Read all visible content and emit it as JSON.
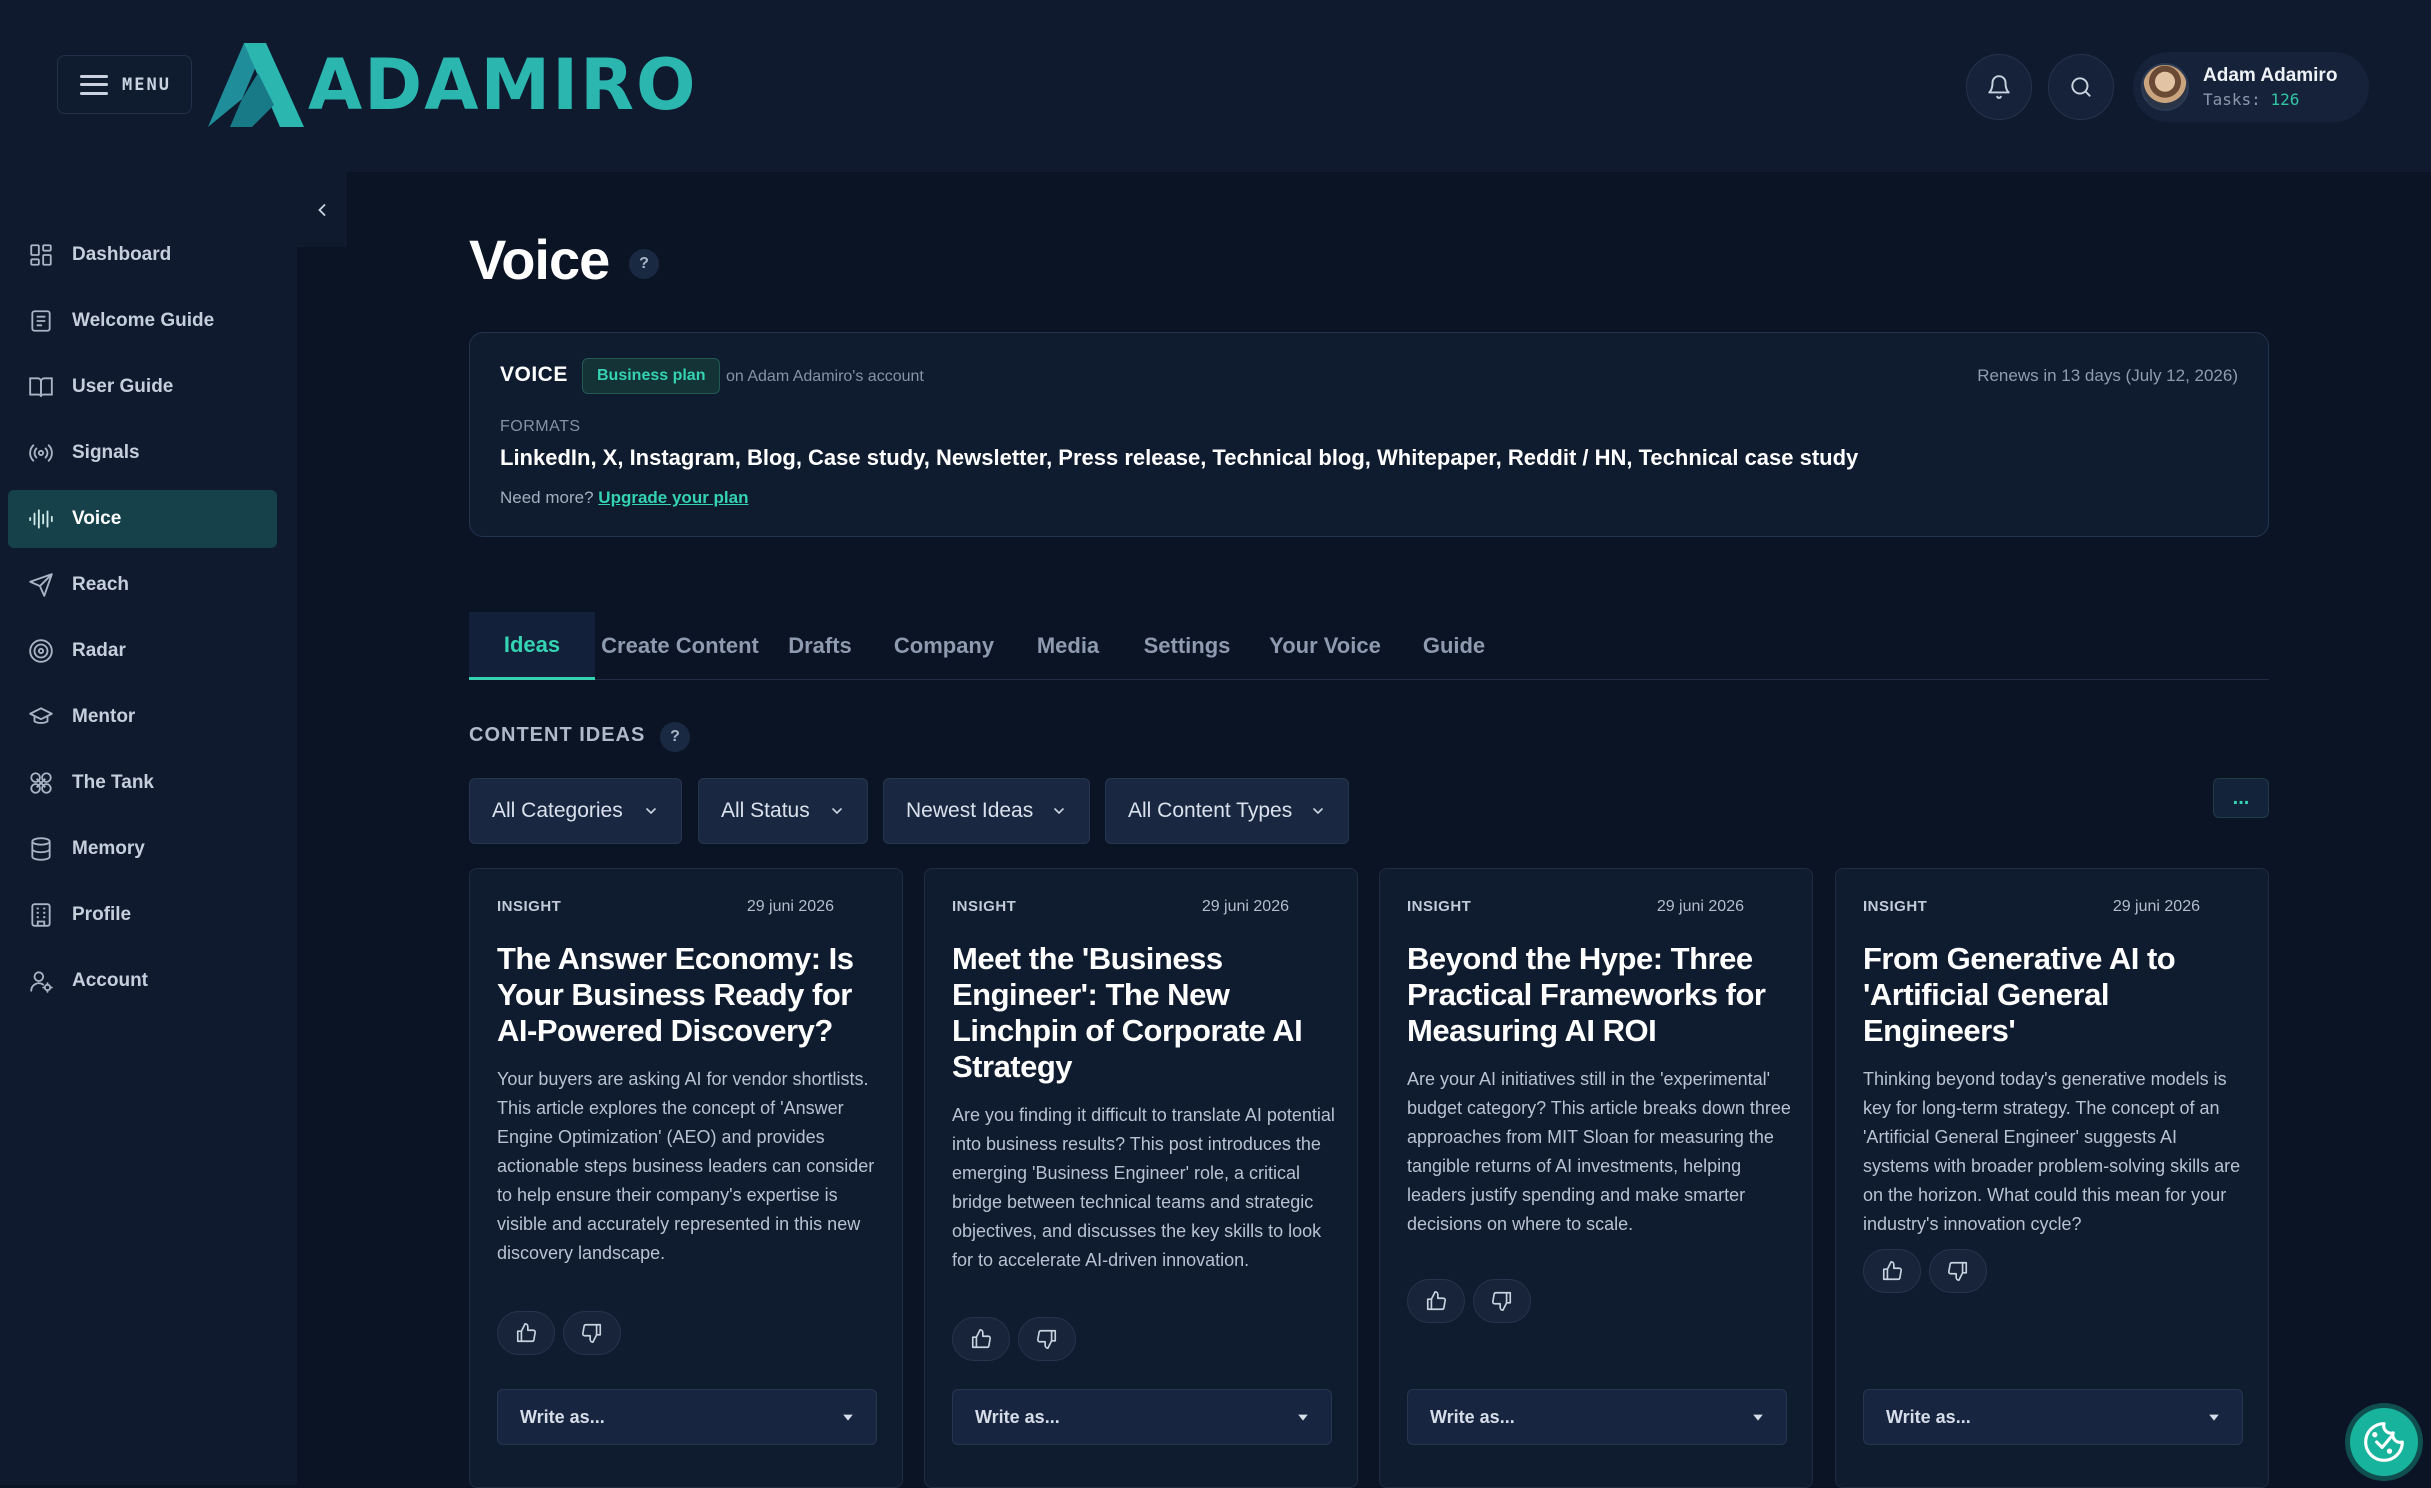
{
  "header": {
    "menu_label": "MENU",
    "logo_text": "ADAMIRO",
    "user": {
      "name": "Adam Adamiro",
      "tasks_label": "Tasks:",
      "tasks_count": "126"
    }
  },
  "sidebar": {
    "items": [
      {
        "label": "Dashboard",
        "icon": "dashboard-icon"
      },
      {
        "label": "Welcome Guide",
        "icon": "document-icon"
      },
      {
        "label": "User Guide",
        "icon": "book-icon"
      },
      {
        "label": "Signals",
        "icon": "signals-icon"
      },
      {
        "label": "Voice",
        "icon": "waveform-icon",
        "active": true
      },
      {
        "label": "Reach",
        "icon": "send-icon"
      },
      {
        "label": "Radar",
        "icon": "radar-icon"
      },
      {
        "label": "Mentor",
        "icon": "graduation-cap-icon"
      },
      {
        "label": "The Tank",
        "icon": "tank-icon"
      },
      {
        "label": "Memory",
        "icon": "database-icon"
      },
      {
        "label": "Profile",
        "icon": "building-icon"
      },
      {
        "label": "Account",
        "icon": "user-gear-icon"
      }
    ]
  },
  "page": {
    "title": "Voice",
    "help": "?"
  },
  "plan": {
    "name": "VOICE",
    "badge": "Business plan",
    "account": "on Adam Adamiro's account",
    "renews": "Renews in 13 days (July 12, 2026)",
    "formats_label": "FORMATS",
    "formats": "LinkedIn, X, Instagram, Blog, Case study, Newsletter, Press release, Technical blog, Whitepaper, Reddit / HN, Technical case study",
    "need_more": "Need more?",
    "upgrade_link": "Upgrade your plan"
  },
  "tabs": [
    "Ideas",
    "Create Content",
    "Drafts",
    "Company",
    "Media",
    "Settings",
    "Your Voice",
    "Guide"
  ],
  "content_ideas": {
    "title": "CONTENT IDEAS",
    "help": "?",
    "filters": [
      "All Categories",
      "All Status",
      "Newest Ideas",
      "All Content Types"
    ],
    "more": "..."
  },
  "cards": [
    {
      "tag": "INSIGHT",
      "date": "29 juni 2026",
      "title": "The Answer Economy: Is Your Business Ready for AI-Powered Discovery?",
      "desc": "Your buyers are asking AI for vendor shortlists. This article explores the concept of 'Answer Engine Optimization' (AEO) and provides actionable steps business leaders can consider to help ensure their company's expertise is visible and accurately represented in this new discovery landscape.",
      "write": "Write as..."
    },
    {
      "tag": "INSIGHT",
      "date": "29 juni 2026",
      "title": "Meet the 'Business Engineer': The New Linchpin of Corporate AI Strategy",
      "desc": "Are you finding it difficult to translate AI potential into business results? This post introduces the emerging 'Business Engineer' role, a critical bridge between technical teams and strategic objectives, and discusses the key skills to look for to accelerate AI-driven innovation.",
      "write": "Write as..."
    },
    {
      "tag": "INSIGHT",
      "date": "29 juni 2026",
      "title": "Beyond the Hype: Three Practical Frameworks for Measuring AI ROI",
      "desc": "Are your AI initiatives still in the 'experimental' budget category? This article breaks down three approaches from MIT Sloan for measuring the tangible returns of AI investments, helping leaders justify spending and make smarter decisions on where to scale.",
      "write": "Write as..."
    },
    {
      "tag": "INSIGHT",
      "date": "29 juni 2026",
      "title": "From Generative AI to 'Artificial General Engineers'",
      "desc": "Thinking beyond today's generative models is key for long-term strategy. The concept of an 'Artificial General Engineer' suggests AI systems with broader problem-solving skills are on the horizon. What could this mean for your industry's innovation cycle?",
      "write": "Write as..."
    }
  ],
  "colors": {
    "accent": "#34d3b1",
    "logo": "#2bb6b0",
    "background": "#0b1424",
    "panel": "#0f1b2e"
  }
}
